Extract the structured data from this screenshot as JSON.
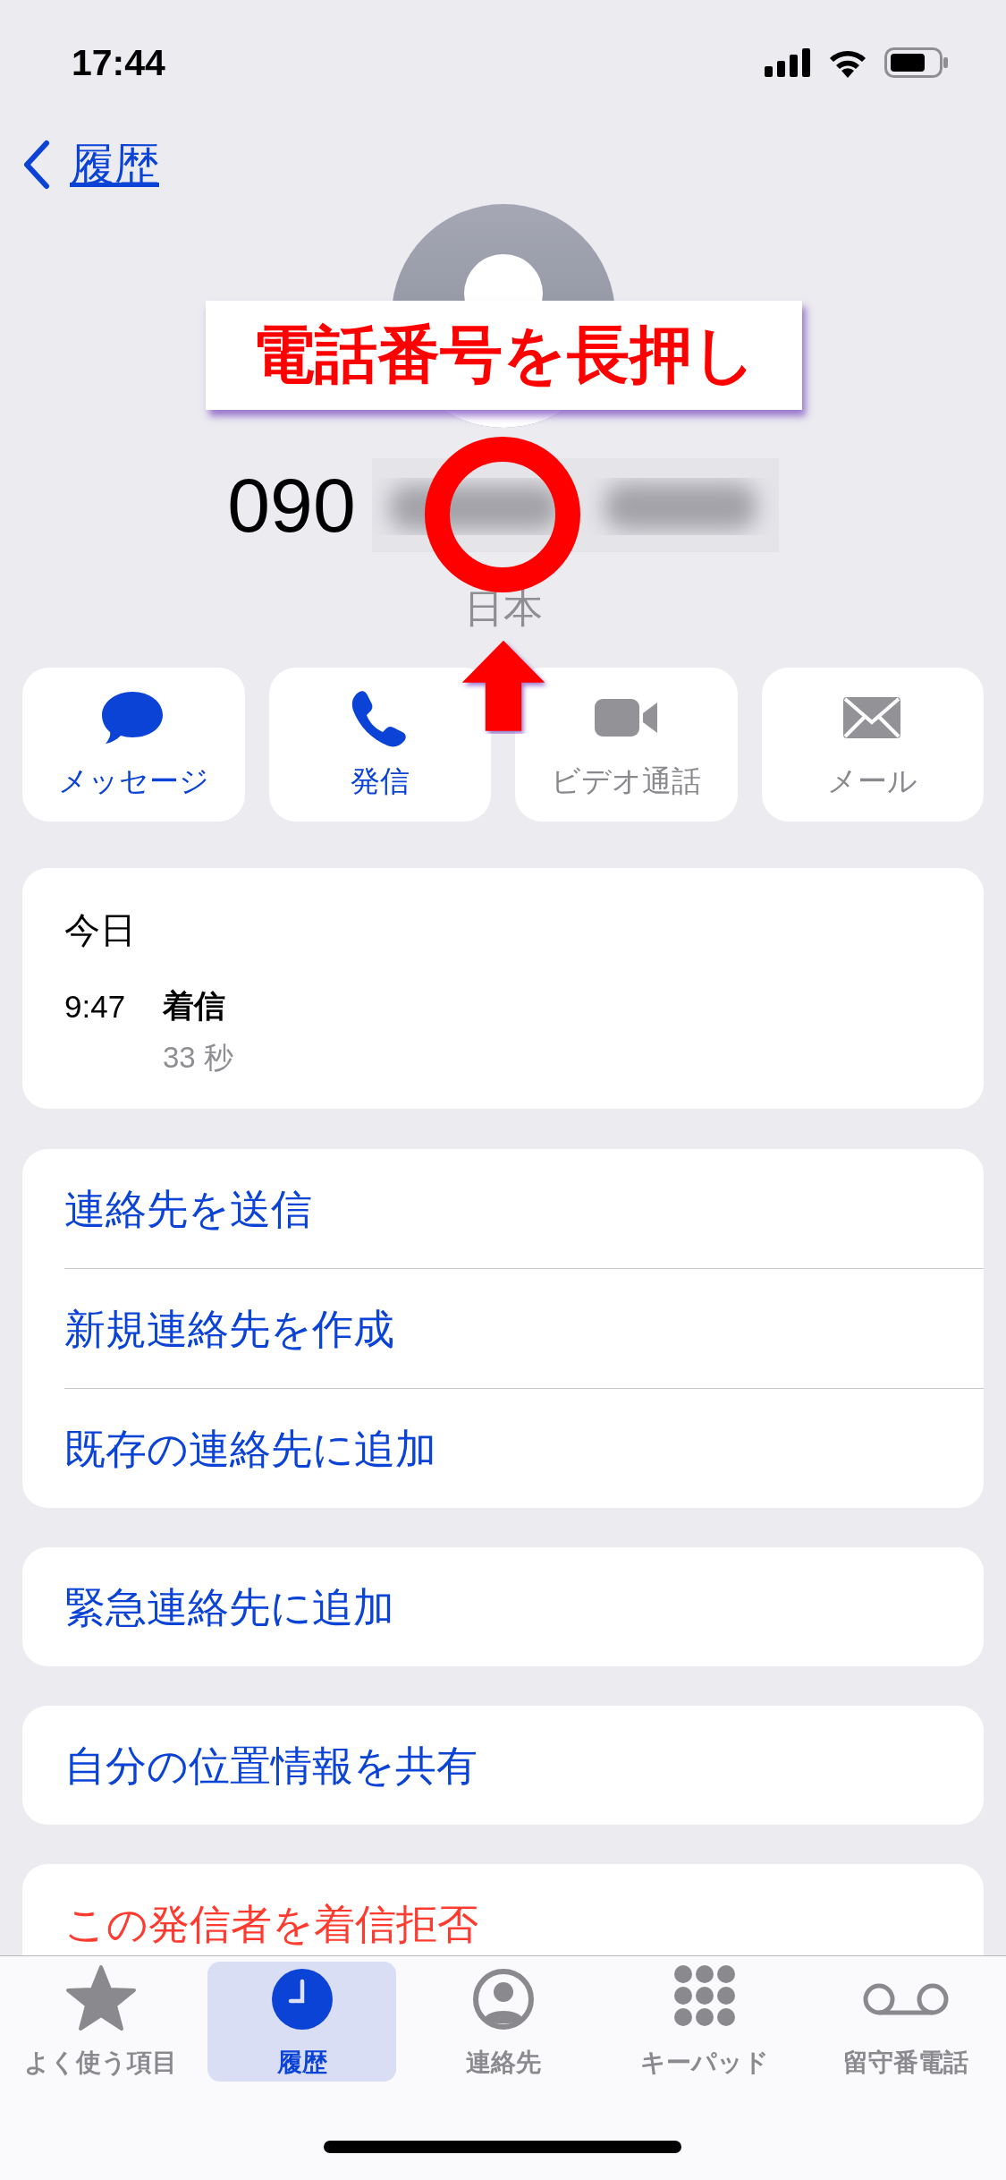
{
  "status_bar": {
    "time": "17:44"
  },
  "nav": {
    "back_label": "履歴"
  },
  "contact": {
    "number_prefix": "090",
    "region": "日本"
  },
  "annotation": {
    "label": "電話番号を長押し"
  },
  "actions": [
    {
      "label": "メッセージ",
      "kind": "message",
      "enabled": true
    },
    {
      "label": "発信",
      "kind": "call",
      "enabled": true
    },
    {
      "label": "ビデオ通話",
      "kind": "video",
      "enabled": false
    },
    {
      "label": "メール",
      "kind": "mail",
      "enabled": false
    }
  ],
  "history": {
    "date": "今日",
    "entries": [
      {
        "time": "9:47",
        "type": "着信",
        "duration": "33 秒"
      }
    ]
  },
  "option_groups": [
    {
      "items": [
        {
          "label": "連絡先を送信",
          "kind": "normal"
        },
        {
          "label": "新規連絡先を作成",
          "kind": "normal"
        },
        {
          "label": "既存の連絡先に追加",
          "kind": "normal"
        }
      ]
    },
    {
      "items": [
        {
          "label": "緊急連絡先に追加",
          "kind": "normal"
        }
      ]
    },
    {
      "items": [
        {
          "label": "自分の位置情報を共有",
          "kind": "normal"
        }
      ]
    },
    {
      "items": [
        {
          "label": "この発信者を着信拒否",
          "kind": "destructive"
        }
      ]
    }
  ],
  "tab_bar": [
    {
      "label": "よく使う項目",
      "kind": "star",
      "selected": false
    },
    {
      "label": "履歴",
      "kind": "clock",
      "selected": true
    },
    {
      "label": "連絡先",
      "kind": "person",
      "selected": false
    },
    {
      "label": "キーパッド",
      "kind": "keypad",
      "selected": false
    },
    {
      "label": "留守番電話",
      "kind": "voicemail",
      "selected": false
    }
  ]
}
